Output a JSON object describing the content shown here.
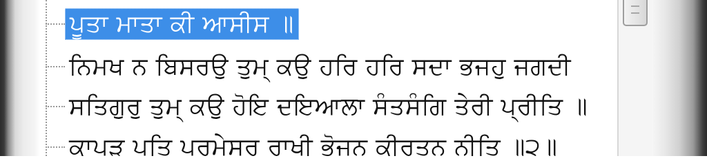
{
  "tree": {
    "items": [
      {
        "label": "ਪੂਤਾ ਮਾਤਾ ਕੀ ਆਸੀਸ ॥",
        "selected": true
      },
      {
        "label": "ਨਿਮਖ ਨ ਬਿਸਰਉ ਤੁਮ੍ ਕਉ ਹਰਿ ਹਰਿ ਸਦਾ ਭਜਹੁ ਜਗਦੀ",
        "selected": false
      },
      {
        "label": "ਸਤਿਗੁਰੁ ਤੁਮ੍ ਕਉ ਹੋਇ ਦਇਆਲਾ ਸੰਤਸੰਗਿ ਤੇਰੀ ਪ੍ਰੀਤਿ ॥",
        "selected": false
      },
      {
        "label": "ਕਾਪੜੁ ਪਤਿ ਪਰਮੇਸਰੁ ਰਾਖੀ ਭੋਜਨੁ ਕੀਰਤਨੁ ਨੀਤਿ ॥੨॥",
        "selected": false
      }
    ]
  },
  "colors": {
    "selection": "#3d8ee8",
    "text": "#111111",
    "tree_lines": "#9a9a9a"
  },
  "icons": {
    "scroll_thumb": "scrollbar-thumb-grip-icon"
  }
}
